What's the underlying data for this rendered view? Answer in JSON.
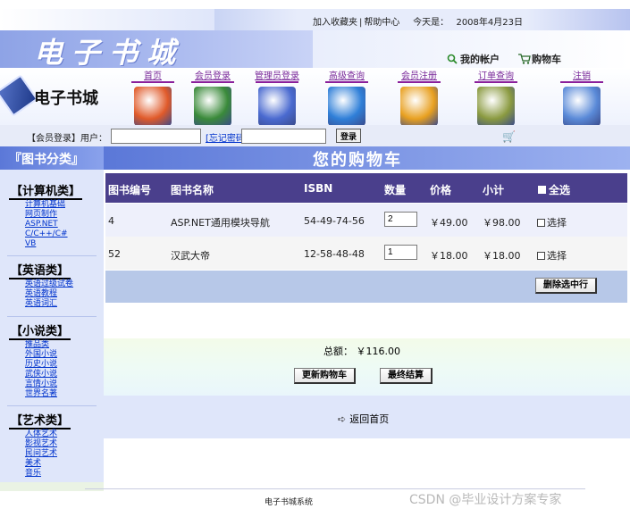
{
  "header": {
    "top_links": [
      "加入收藏夹",
      "帮助中心",
      "今天是：",
      "2008年4月23日"
    ],
    "site_title": "电子书城",
    "logo_text": "电子书城",
    "my_account": "我的帐户",
    "cart": "购物车"
  },
  "nav": [
    {
      "label": "首页",
      "color": "#e05a2a"
    },
    {
      "label": "会员登录",
      "color": "#3a8a3a"
    },
    {
      "label": "管理员登录",
      "color": "#4a6ad0"
    },
    {
      "label": "高级查询",
      "color": "#2f7fd8"
    },
    {
      "label": "会员注册",
      "color": "#e8a020"
    },
    {
      "label": "订单查询",
      "color": "#8a9a40"
    },
    {
      "label": "注销",
      "color": "#5a8ad8"
    }
  ],
  "login": {
    "label": "【会员登录】用户：",
    "forgot": "[忘记密码",
    "button": "登录"
  },
  "sidebar": {
    "title": "『图书分类』",
    "categories": [
      {
        "title": "【计算机类】",
        "items": [
          "计算机基础",
          "网页制作",
          "ASP.NET",
          "C/C++/C#",
          "VB"
        ]
      },
      {
        "title": "【英语类】",
        "items": [
          "英语过级试卷",
          "英语教程",
          "英语词汇"
        ]
      },
      {
        "title": "【小说类】",
        "items": [
          "推品类",
          "外国小说",
          "历史小说",
          "武侠小说",
          "言情小说",
          "世界名著"
        ]
      },
      {
        "title": "【艺术类】",
        "items": [
          "人体艺术",
          "影视艺术",
          "民间艺术",
          "美术",
          "音乐"
        ]
      }
    ]
  },
  "main": {
    "title": "您的购物车",
    "columns": [
      "图书编号",
      "图书名称",
      "ISBN",
      "数量",
      "价格",
      "小计",
      "全选"
    ],
    "rows": [
      {
        "id": "4",
        "name": "ASP.NET通用模块导航",
        "isbn": "54-49-74-56",
        "qty": "2",
        "price": "￥49.00",
        "subtotal": "￥98.00",
        "select": "选择"
      },
      {
        "id": "52",
        "name": "汉武大帝",
        "isbn": "12-58-48-48",
        "qty": "1",
        "price": "￥18.00",
        "subtotal": "￥18.00",
        "select": "选择"
      }
    ],
    "delete_button": "删除选中行",
    "total_label": "总额：",
    "total_value": "￥116.00",
    "update_button": "更新购物车",
    "checkout_button": "最终结算",
    "back_home": "返回首页"
  },
  "footer": {
    "text": "电子书城系统",
    "watermark": "CSDN @毕业设计方案专家"
  }
}
